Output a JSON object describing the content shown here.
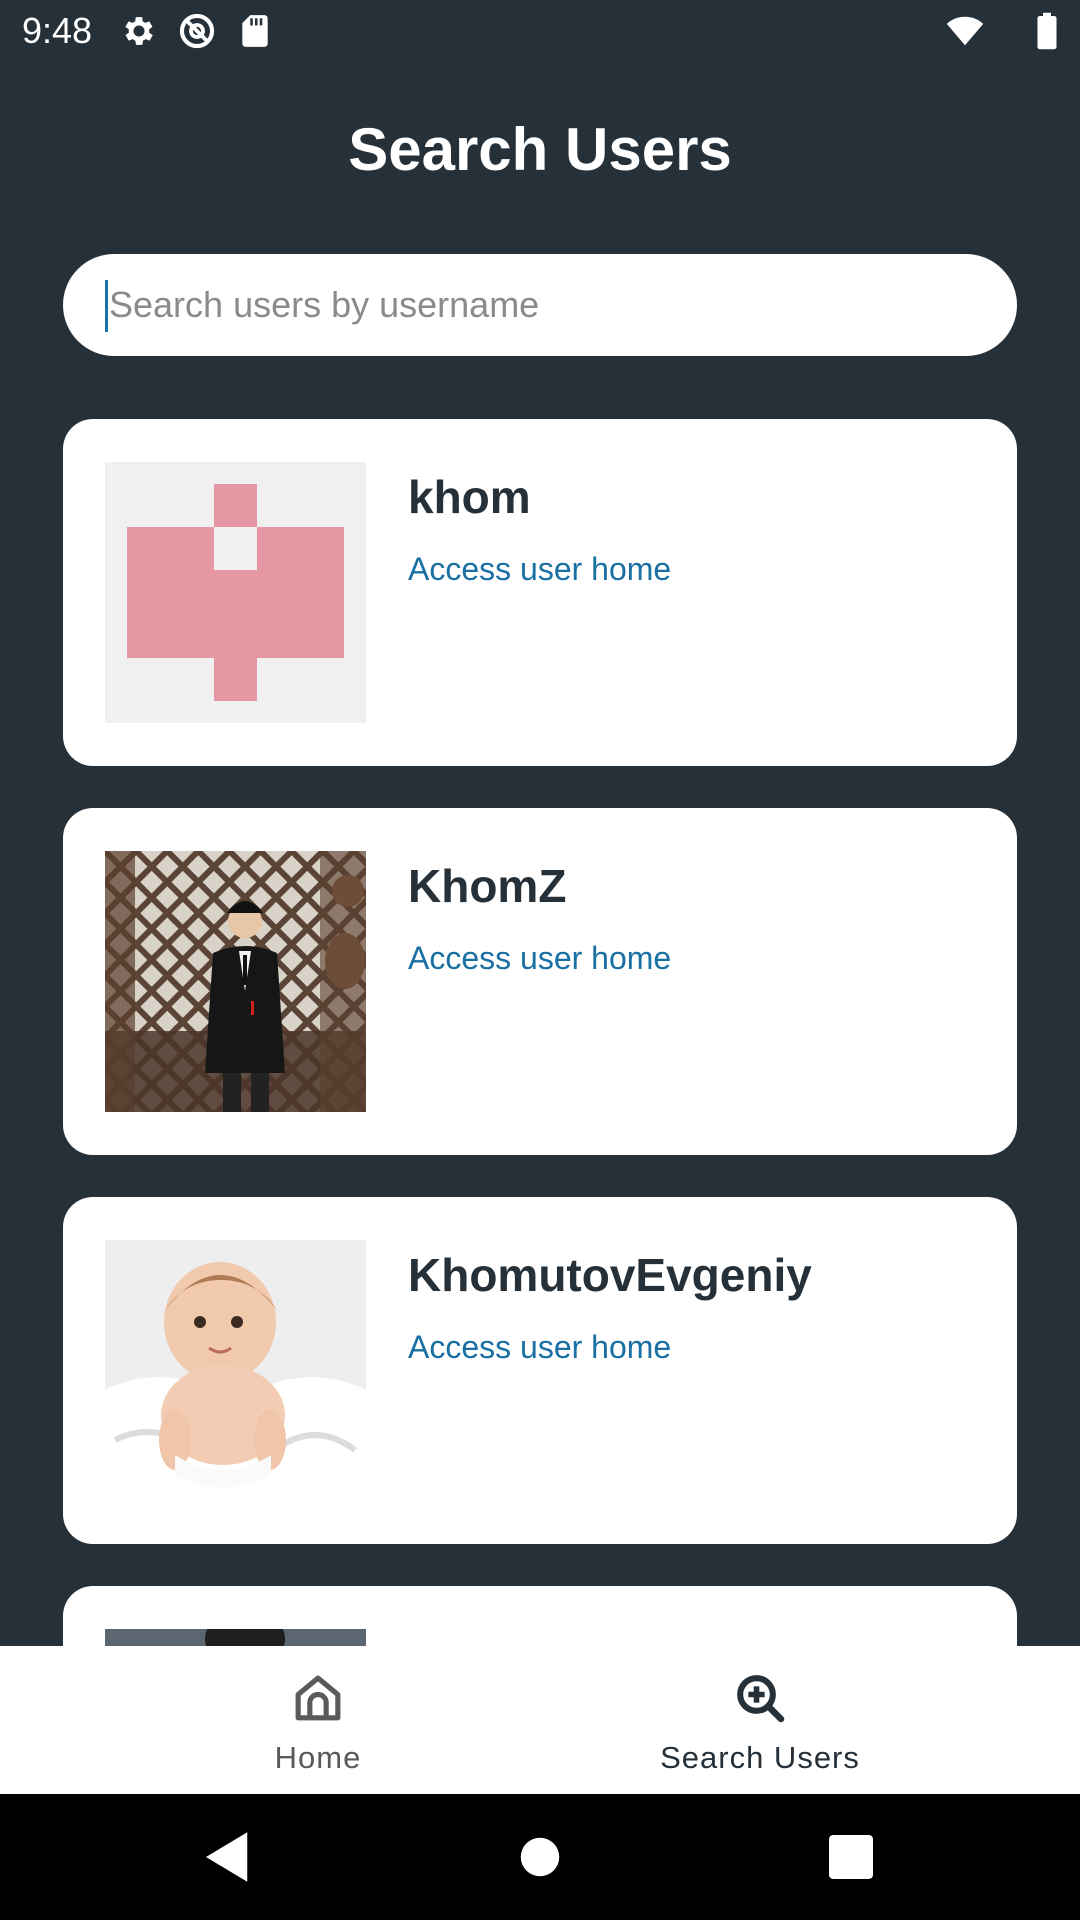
{
  "status_bar": {
    "time": "9:48",
    "icons_left": [
      "gear-icon",
      "at-sign-icon",
      "sd-card-icon"
    ],
    "icons_right": [
      "wifi-icon",
      "battery-icon"
    ]
  },
  "header": {
    "title": "Search Users"
  },
  "search": {
    "placeholder": "Search users by username",
    "value": ""
  },
  "users": [
    {
      "username": "khom",
      "link_label": "Access user home",
      "avatar": "pink-identicon"
    },
    {
      "username": "KhomZ",
      "link_label": "Access user home",
      "avatar": "photo-man-in-suit"
    },
    {
      "username": "KhomutovEvgeniy",
      "link_label": "Access user home",
      "avatar": "photo-baby"
    },
    {
      "username": "",
      "link_label": "",
      "avatar": "photo-partial"
    }
  ],
  "bottom_nav": {
    "items": [
      {
        "label": "Home",
        "icon": "home-icon",
        "active": false
      },
      {
        "label": "Search Users",
        "icon": "search-plus-icon",
        "active": true
      }
    ]
  },
  "system_nav": {
    "buttons": [
      "back-icon",
      "home-circle-icon",
      "recents-icon"
    ]
  },
  "colors": {
    "background": "#263039",
    "card": "#ffffff",
    "link": "#1a6fa3",
    "identicon_pink": "#e597a3",
    "identicon_bg": "#f0f0f0"
  }
}
